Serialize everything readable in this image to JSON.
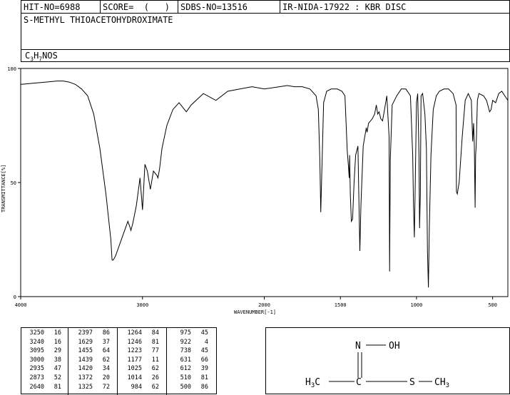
{
  "header": {
    "hit_no": "HIT-NO=6988",
    "score": "SCORE=  (   )",
    "sdbs_no": "SDBS-NO=13516",
    "method": "IR-NIDA-17922 : KBR DISC"
  },
  "compound_name": "S-METHYL THIOACETOHYDROXIMATE",
  "formula": {
    "c": "C",
    "c_n": "3",
    "h": "H",
    "h_n": "7",
    "rest": "NOS"
  },
  "chart_data": {
    "type": "line",
    "xlabel": "WAVENUMBER[-1]",
    "ylabel": "TRANSMITTANCE[%]",
    "xlim": [
      4000,
      400
    ],
    "ylim": [
      0,
      100
    ],
    "x_ticks": [
      4000,
      3000,
      2000,
      1500,
      1000,
      500
    ],
    "y_ticks": [
      0,
      50,
      100
    ],
    "grid": false,
    "series": [
      {
        "x": [
          4000,
          3900,
          3800,
          3700,
          3650,
          3600,
          3550,
          3500,
          3450,
          3400,
          3350,
          3300,
          3260,
          3250,
          3240,
          3220,
          3180,
          3120,
          3100,
          3095,
          3080,
          3050,
          3020,
          3000,
          2990,
          2980,
          2960,
          2935,
          2910,
          2880,
          2873,
          2860,
          2840,
          2800,
          2750,
          2700,
          2640,
          2600,
          2500,
          2397,
          2300,
          2200,
          2100,
          2000,
          1900,
          1850,
          1800,
          1750,
          1700,
          1660,
          1645,
          1635,
          1629,
          1622,
          1610,
          1590,
          1560,
          1520,
          1490,
          1470,
          1455,
          1448,
          1442,
          1439,
          1435,
          1428,
          1420,
          1410,
          1400,
          1385,
          1378,
          1372,
          1365,
          1350,
          1330,
          1325,
          1315,
          1290,
          1275,
          1264,
          1255,
          1246,
          1235,
          1223,
          1210,
          1195,
          1180,
          1177,
          1172,
          1160,
          1130,
          1100,
          1070,
          1040,
          1025,
          1020,
          1014,
          1008,
          1000,
          992,
          984,
          980,
          975,
          970,
          960,
          945,
          935,
          928,
          922,
          916,
          905,
          890,
          870,
          850,
          820,
          790,
          760,
          740,
          738,
          732,
          720,
          700,
          680,
          660,
          640,
          631,
          625,
          620,
          615,
          612,
          608,
          600,
          590,
          560,
          540,
          520,
          510,
          500,
          480,
          460,
          440,
          420,
          400
        ],
        "y": [
          93,
          93.5,
          94,
          94.5,
          94.5,
          94,
          93,
          91,
          88,
          80,
          65,
          45,
          25,
          16,
          16,
          18,
          24,
          33,
          30,
          29,
          32,
          40,
          52,
          38,
          48,
          58,
          55,
          47,
          55,
          53,
          52,
          56,
          65,
          75,
          82,
          85,
          81,
          84,
          89,
          86,
          90,
          91,
          92,
          91,
          92,
          92.5,
          92,
          92,
          91,
          88,
          82,
          60,
          37,
          55,
          85,
          90,
          91,
          91,
          90,
          88,
          64,
          58,
          52,
          62,
          45,
          33,
          34,
          50,
          62,
          66,
          40,
          20,
          40,
          66,
          74,
          72,
          76,
          78,
          80,
          84,
          80,
          81,
          78,
          77,
          82,
          88,
          70,
          11,
          60,
          84,
          88,
          91,
          91,
          88,
          62,
          40,
          26,
          50,
          85,
          89,
          62,
          30,
          45,
          88,
          89,
          80,
          65,
          20,
          4,
          30,
          62,
          82,
          88,
          90,
          91,
          91,
          89,
          84,
          46,
          45,
          50,
          70,
          86,
          89,
          86,
          68,
          76,
          66,
          39,
          62,
          66,
          86,
          89,
          88,
          86,
          81,
          82,
          86,
          85,
          89,
          90,
          88,
          86
        ],
        "color": "#000000"
      }
    ],
    "peak_table": {
      "columns": [
        [
          [
            "3250",
            "16"
          ],
          [
            "3240",
            "16"
          ],
          [
            "3095",
            "29"
          ],
          [
            "3000",
            "38"
          ],
          [
            "2935",
            "47"
          ],
          [
            "2873",
            "52"
          ],
          [
            "2640",
            "81"
          ]
        ],
        [
          [
            "2397",
            "86"
          ],
          [
            "1629",
            "37"
          ],
          [
            "1455",
            "64"
          ],
          [
            "1439",
            "62"
          ],
          [
            "1420",
            "34"
          ],
          [
            "1372",
            "20"
          ],
          [
            "1325",
            "72"
          ]
        ],
        [
          [
            "1264",
            "84"
          ],
          [
            "1246",
            "81"
          ],
          [
            "1223",
            "77"
          ],
          [
            "1177",
            "11"
          ],
          [
            "1025",
            "62"
          ],
          [
            "1014",
            "26"
          ],
          [
            "984",
            "62"
          ]
        ],
        [
          [
            "975",
            "45"
          ],
          [
            "922",
            "4"
          ],
          [
            "738",
            "45"
          ],
          [
            "631",
            "66"
          ],
          [
            "612",
            "39"
          ],
          [
            "510",
            "81"
          ],
          [
            "500",
            "86"
          ]
        ]
      ]
    }
  },
  "structure": {
    "n": "N",
    "o_h": "OH",
    "c1": "H",
    "c1_sub": "3",
    "c1_c": "C",
    "c_center": "C",
    "s": "S",
    "c2": "CH",
    "c2_sub": "3"
  }
}
